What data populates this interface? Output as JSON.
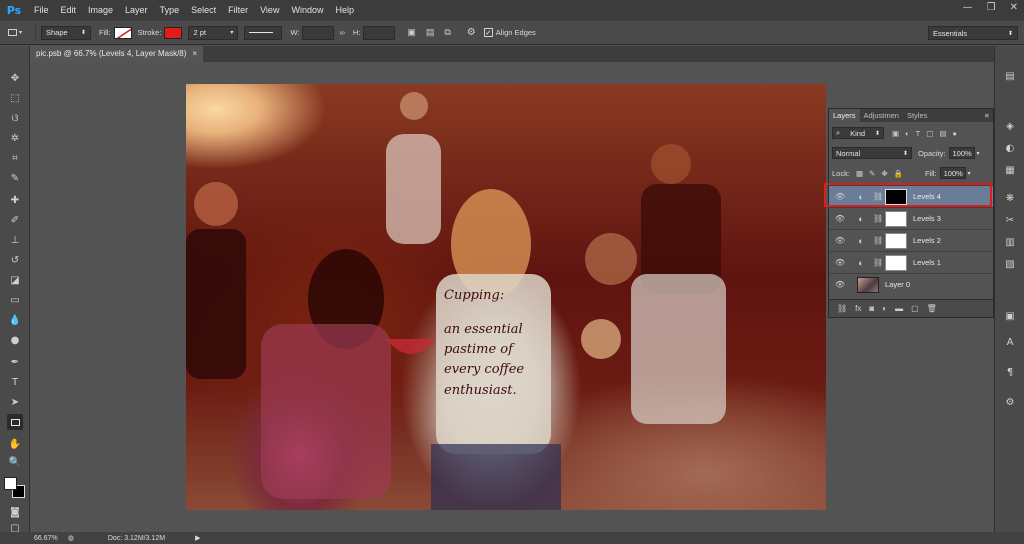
{
  "app": {
    "logo": "Ps"
  },
  "menu": [
    "File",
    "Edit",
    "Image",
    "Layer",
    "Type",
    "Select",
    "Filter",
    "View",
    "Window",
    "Help"
  ],
  "window_controls": {
    "minimize": "—",
    "restore": "❐",
    "close": "✕"
  },
  "options": {
    "tool_mode": "Shape",
    "fill_label": "Fill:",
    "stroke_label": "Stroke:",
    "stroke_color": "#e21b1b",
    "stroke_width": "2 pt",
    "w_label": "W:",
    "h_label": "H:",
    "align_edges_label": "Align Edges",
    "align_edges_checked": true,
    "workspace": "Essentials"
  },
  "document": {
    "tab_title": "pic.psb @ 66.7% (Levels 4, Layer Mask/8)",
    "close": "×"
  },
  "image_text": [
    "Cupping:",
    "an essential",
    "pastime of",
    "every coffee",
    "enthusiast."
  ],
  "layers_panel": {
    "tabs": [
      "Layers",
      "Adjustmen",
      "Styles"
    ],
    "active_tab": "Layers",
    "filter_kind": "Kind",
    "blend_mode": "Normal",
    "opacity_label": "Opacity:",
    "opacity": "100%",
    "lock_label": "Lock:",
    "fill_label": "Fill:",
    "fill": "100%",
    "layers": [
      {
        "name": "Levels 4",
        "selected": true,
        "mask": "black"
      },
      {
        "name": "Levels 3",
        "selected": false,
        "mask": "white"
      },
      {
        "name": "Levels 2",
        "selected": false,
        "mask": "white"
      },
      {
        "name": "Levels 1",
        "selected": false,
        "mask": "white"
      },
      {
        "name": "Layer 0",
        "selected": false,
        "mask": "photo"
      }
    ],
    "footer_icons": [
      "link-icon",
      "fx-icon",
      "mask-icon",
      "adjustment-icon",
      "folder-icon",
      "new-layer-icon",
      "trash-icon"
    ]
  },
  "highlight_color": "#e01b1b",
  "status": {
    "zoom": "66.67%",
    "doc_info": "Doc: 3.12M/3.12M"
  }
}
